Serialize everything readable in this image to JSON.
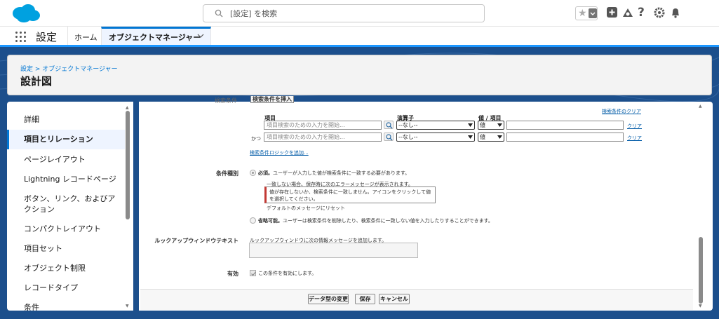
{
  "header": {
    "search_placeholder": "[設定] を検索",
    "icons": [
      "star-icon",
      "chevron-down-icon",
      "add-icon",
      "trailhead-icon",
      "help-icon",
      "gear-icon",
      "bell-icon"
    ]
  },
  "nav": {
    "app_name": "設定",
    "tabs": [
      {
        "label": "ホーム"
      },
      {
        "label": "オブジェクトマネージャー"
      }
    ]
  },
  "page": {
    "breadcrumb": "設定 > オブジェクトマネージャー",
    "title": "設計図"
  },
  "sidebar": {
    "items": [
      {
        "label": "詳細"
      },
      {
        "label": "項目とリレーション"
      },
      {
        "label": "ページレイアウト"
      },
      {
        "label": "Lightning レコードページ"
      },
      {
        "label": "ボタン、リンク、およびアクション"
      },
      {
        "label": "コンパクトレイアウト"
      },
      {
        "label": "項目セット"
      },
      {
        "label": "オブジェクト制限"
      },
      {
        "label": "レコードタイプ"
      },
      {
        "label": "条件"
      }
    ]
  },
  "filter": {
    "cut_label": "検索条件",
    "insert_button": "検索条件を挿入",
    "clear_all": "検索条件のクリア",
    "col_field": "項目",
    "col_operator": "演算子",
    "col_value": "値 / 項目",
    "rows": [
      {
        "prefix": "",
        "field_placeholder": "項目検索のための入力を開始...",
        "operator": "--なし--",
        "value_type": "値",
        "value": "",
        "clear": "クリア"
      },
      {
        "prefix": "かつ",
        "field_placeholder": "項目検索のための入力を開始...",
        "operator": "--なし--",
        "value_type": "値",
        "value": "",
        "clear": "クリア"
      }
    ],
    "add_logic": "検索条件ロジックを追加..."
  },
  "filter_type": {
    "label": "条件種別",
    "required_title": "必須。",
    "required_desc": "ユーザーが入力した値が検索条件に一致する必要があります。",
    "mismatch_label": "一致しない場合、保存時に次のエラーメッセージが表示されます。",
    "error_message": "値が存在しないか、検索条件に一致しません。アイコンをクリックして値を選択してください。",
    "reset_link": "デフォルトのメッセージにリセット",
    "optional_title": "省略可能。",
    "optional_desc": "ユーザーは検索条件を削除したり、検索条件に一致しない値を入力したりすることができます。"
  },
  "lookup_window": {
    "label": "ルックアップウィンドウテキスト",
    "desc": "ルックアップウィンドウに次の情報メッセージを追加します。"
  },
  "active": {
    "label": "有効",
    "checkbox_label": "この条件を有効にします。"
  },
  "buttons": {
    "change_type": "データ型の変更",
    "save": "保存",
    "cancel": "キャンセル"
  },
  "colors": {
    "brand": "#0176d3",
    "band": "#1c4f8c",
    "error_bar": "#c23934"
  }
}
